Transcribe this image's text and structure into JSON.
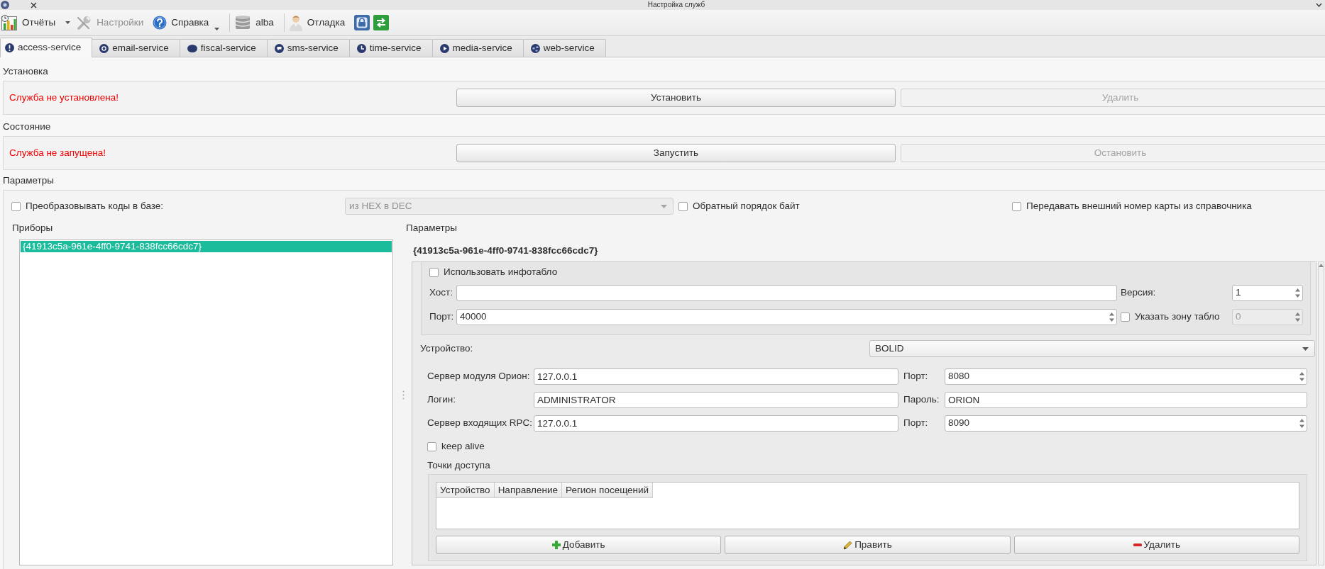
{
  "window": {
    "title": "Настройка служб"
  },
  "toolbar": [
    {
      "kind": "button",
      "label": "Отчёты",
      "disabled": false,
      "dropdown": true,
      "menu_indicator": false
    },
    {
      "kind": "button",
      "label": "Настройки",
      "disabled": true,
      "dropdown": false,
      "menu_indicator": false
    },
    {
      "kind": "button",
      "label": "Справка",
      "disabled": false,
      "dropdown": false,
      "menu_indicator": true
    },
    {
      "kind": "separator"
    },
    {
      "kind": "button",
      "label": "alba",
      "disabled": false,
      "dropdown": false,
      "menu_indicator": false
    },
    {
      "kind": "separator"
    },
    {
      "kind": "button",
      "label": "Отладка",
      "disabled": false,
      "dropdown": false,
      "menu_indicator": false
    },
    {
      "kind": "button",
      "disabled": false,
      "dropdown": false,
      "menu_indicator": false
    },
    {
      "kind": "button",
      "disabled": false,
      "dropdown": false,
      "menu_indicator": false
    }
  ],
  "tabs": [
    {
      "label": "access-service",
      "selected": true
    },
    {
      "label": "email-service",
      "selected": false
    },
    {
      "label": "fiscal-service",
      "selected": false
    },
    {
      "label": "sms-service",
      "selected": false
    },
    {
      "label": "time-service",
      "selected": false
    },
    {
      "label": "media-service",
      "selected": false
    },
    {
      "label": "web-service",
      "selected": false
    }
  ],
  "installation": {
    "title": "Установка",
    "status": "Служба не установлена!",
    "buttons": [
      {
        "label": "Установить",
        "disabled": false
      },
      {
        "label": "Удалить",
        "disabled": true
      }
    ]
  },
  "state": {
    "title": "Состояние",
    "status": "Служба не запущена!",
    "buttons": [
      {
        "label": "Запустить",
        "disabled": false
      },
      {
        "label": "Остановить",
        "disabled": true
      }
    ]
  },
  "parameters": {
    "title": "Параметры",
    "convert_codes": {
      "label": "Преобразовывать коды в базе:",
      "checked": false
    },
    "conversion": {
      "value": "из HEX в DEC",
      "disabled": true
    },
    "reverse_bytes": {
      "label": "Обратный порядок байт",
      "checked": false
    },
    "external_card_number": {
      "label": "Передавать внешний номер карты из справочника",
      "checked": false
    }
  },
  "devices": {
    "title": "Приборы",
    "items": [
      {
        "label": "{41913c5a-961e-4ff0-9741-838fcc66cdc7}",
        "selected": true
      }
    ]
  },
  "device_parameters": {
    "title": "Параметры",
    "heading": "{41913c5a-961e-4ff0-9741-838fcc66cdc7}",
    "infotablo": {
      "label": "Использовать инфотабло",
      "checked": false,
      "host": {
        "label": "Хост:"
      },
      "version": {
        "label": "Версия:",
        "value": "1"
      },
      "port": {
        "label": "Порт:",
        "value": "40000"
      },
      "zone": {
        "label": "Указать зону табло",
        "checked": false,
        "value": "0",
        "disabled": true
      }
    },
    "device": {
      "label": "Устройство:",
      "value": "BOLID"
    },
    "fields": [
      {
        "label": "Сервер модуля Орион:",
        "value": "127.0.0.1",
        "kind": "text"
      },
      {
        "label": "Порт:",
        "value": "8080",
        "kind": "spin"
      },
      {
        "label": "Логин:",
        "value": "ADMINISTRATOR",
        "kind": "text"
      },
      {
        "label": "Пароль:",
        "value": "ORION",
        "kind": "text"
      },
      {
        "label": "Сервер входящих RPC:",
        "value": "127.0.0.1",
        "kind": "text"
      },
      {
        "label": "Порт:",
        "value": "8090",
        "kind": "spin"
      }
    ],
    "keep_alive": {
      "label": "keep alive",
      "checked": false
    },
    "access_points": {
      "title": "Точки доступа",
      "columns": [
        "Устройство",
        "Направление",
        "Регион посещений"
      ],
      "buttons": [
        {
          "label": "Добавить"
        },
        {
          "label": "Править"
        },
        {
          "label": "Удалить"
        }
      ]
    }
  }
}
